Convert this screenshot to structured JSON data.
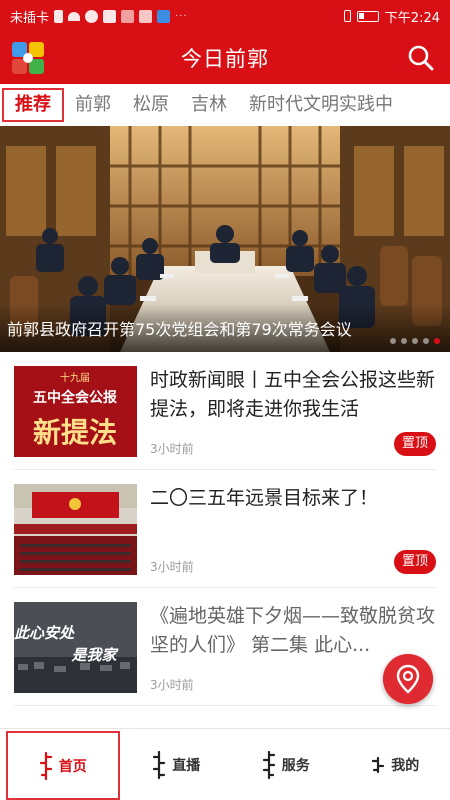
{
  "status_bar": {
    "carrier": "未插卡",
    "time": "下午2:24"
  },
  "header": {
    "title": "今日前郭"
  },
  "tabs": [
    {
      "label": "推荐",
      "active": true
    },
    {
      "label": "前郭",
      "active": false
    },
    {
      "label": "松原",
      "active": false
    },
    {
      "label": "吉林",
      "active": false
    },
    {
      "label": "新时代文明实践中",
      "active": false
    }
  ],
  "banner": {
    "caption": "前郭县政府召开第75次党组会和第79次常务会议",
    "slide_count": 5,
    "active_slide": 4
  },
  "news": [
    {
      "title": "时政新闻眼丨五中全会公报这些新提法，即将走进你我生活",
      "time": "3小时前",
      "pinned_label": "置顶",
      "thumb_text": {
        "line1": "十九届",
        "line2": "五中全会公报",
        "line3": "新提法"
      }
    },
    {
      "title": "二〇三五年远景目标来了！",
      "time": "3小时前",
      "pinned_label": "置顶"
    },
    {
      "title": "《遍地英雄下夕烟——致敬脱贫攻坚的人们》 第二集 此心...",
      "time": "3小时前",
      "thumb_text": {
        "line1": "此心安处",
        "line2": "是我家"
      }
    }
  ],
  "bottom_nav": [
    {
      "label": "首页",
      "active": true
    },
    {
      "label": "直播",
      "active": false
    },
    {
      "label": "服务",
      "active": false
    },
    {
      "label": "我的",
      "active": false
    }
  ],
  "colors": {
    "brand_red": "#d81016",
    "pin_red": "#d81016",
    "text_dark": "#222222",
    "text_muted": "#9a9a9a"
  },
  "icons": [
    "app-logo-icon",
    "search-icon",
    "location-pin-icon",
    "mongolian-script-icon"
  ]
}
